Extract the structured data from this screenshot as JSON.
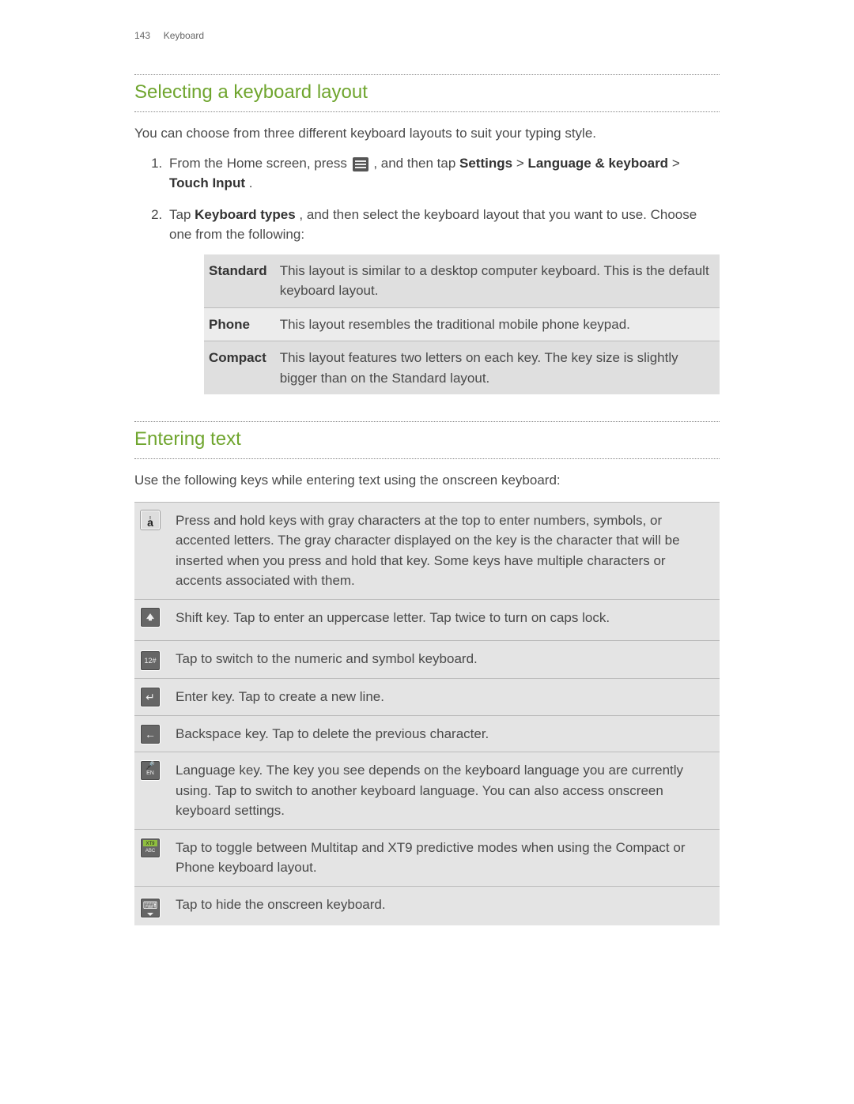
{
  "header": {
    "page_num": "143",
    "section": "Keyboard"
  },
  "section1": {
    "title": "Selecting a keyboard layout",
    "intro": "You can choose from three different keyboard layouts to suit your typing style.",
    "step1": {
      "pre": "From the Home screen, press ",
      "mid": ", and then tap ",
      "b1": "Settings",
      "gt1": " > ",
      "b2": "Language & keyboard",
      "gt2": " > ",
      "b3": "Touch Input",
      "end": "."
    },
    "step2": {
      "pre": "Tap ",
      "b1": "Keyboard types",
      "post": ", and then select the keyboard layout that you want to use. Choose one from the following:"
    },
    "table": {
      "r1": {
        "label": "Standard",
        "desc": "This layout is similar to a desktop computer keyboard. This is the default keyboard layout."
      },
      "r2": {
        "label": "Phone",
        "desc": "This layout resembles the traditional mobile phone keypad."
      },
      "r3": {
        "label": "Compact",
        "desc": "This layout features two letters on each key. The key size is slightly bigger than on the Standard layout."
      }
    }
  },
  "section2": {
    "title": "Entering text",
    "intro": "Use the following keys while entering text using the onscreen keyboard:",
    "rows": {
      "r1": "Press and hold keys with gray characters at the top to enter numbers, symbols, or accented letters. The gray character displayed on the key is the character that will be inserted when you press and hold that key. Some keys have multiple characters or accents associated with them.",
      "r2": "Shift key. Tap to enter an uppercase letter. Tap twice to turn on caps lock.",
      "r3": "Tap to switch to the numeric and symbol keyboard.",
      "r4": "Enter key. Tap to create a new line.",
      "r5": "Backspace key. Tap to delete the previous character.",
      "r6": "Language key. The key you see depends on the keyboard language you are currently using. Tap to switch to another keyboard language. You can also access onscreen keyboard settings.",
      "r7": "Tap to toggle between Multitap and XT9 predictive modes when using the Compact or Phone keyboard layout.",
      "r8": "Tap to hide the onscreen keyboard."
    },
    "key_labels": {
      "a": "a",
      "num": "12#",
      "lang_sub": "EN",
      "xt9_l1": "XT9",
      "xt9_l2": "ABC"
    }
  }
}
